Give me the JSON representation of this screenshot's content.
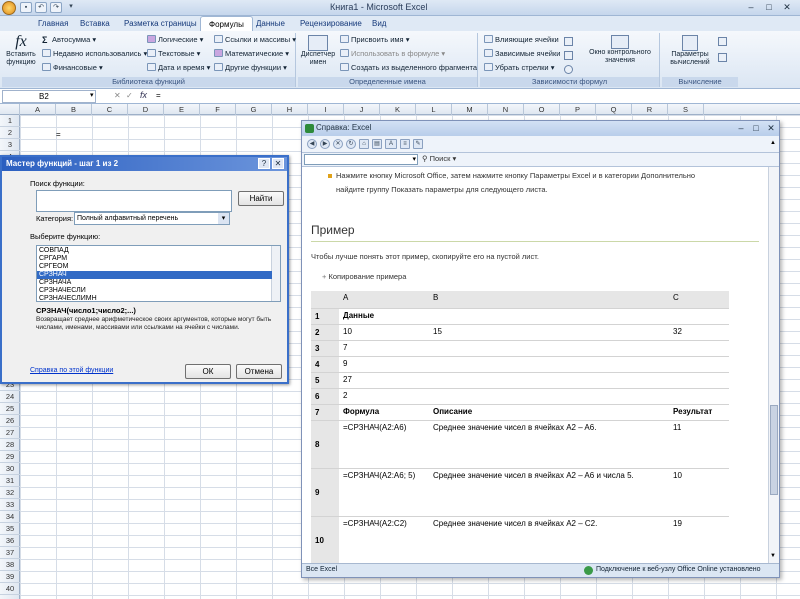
{
  "window": {
    "title": "Книга1 - Microsoft Excel"
  },
  "qat": [
    "save",
    "undo",
    "redo",
    "customize"
  ],
  "tabs": [
    "Главная",
    "Вставка",
    "Разметка страницы",
    "Формулы",
    "Данные",
    "Рецензирование",
    "Вид"
  ],
  "active_tab": "Формулы",
  "ribbon": {
    "insert_function": "Вставить функцию",
    "lib_col1": [
      "Автосумма",
      "Недавно использовались",
      "Финансовые"
    ],
    "lib_col2": [
      "Логические",
      "Текстовые",
      "Дата и время"
    ],
    "lib_col3": [
      "Ссылки и массивы",
      "Математические",
      "Другие функции"
    ],
    "group_library": "Библиотека функций",
    "name_manager": "Диспетчер имен",
    "names_items": [
      "Присвоить имя",
      "Использовать в формуле",
      "Создать из выделенного фрагмента"
    ],
    "group_names": "Определенные имена",
    "dep_items": [
      "Влияющие ячейки",
      "Зависимые ячейки",
      "Убрать стрелки"
    ],
    "watch_window": "Окно контрольного значения",
    "group_deps": "Зависимости формул",
    "calc_options": "Параметры вычислений",
    "group_calc": "Вычисление"
  },
  "formula_bar": {
    "name_box": "B2",
    "fx": "fx",
    "value": "="
  },
  "columns": [
    "A",
    "B",
    "C",
    "D",
    "E",
    "F",
    "G",
    "H",
    "I",
    "J",
    "K",
    "L",
    "M",
    "N",
    "O",
    "P",
    "Q",
    "R",
    "S"
  ],
  "rows": [
    "1",
    "2",
    "3",
    "4",
    "5",
    "6",
    "7",
    "8",
    "9",
    "10",
    "11",
    "12",
    "13",
    "14",
    "15",
    "16",
    "17",
    "18",
    "19",
    "20",
    "21",
    "22",
    "23",
    "24",
    "25",
    "26",
    "27",
    "28",
    "29",
    "30",
    "31",
    "32",
    "33",
    "34",
    "35",
    "36",
    "37",
    "38",
    "39",
    "40"
  ],
  "cell_b2": "=",
  "dialog": {
    "title": "Мастер функций - шаг 1 из 2",
    "search_label": "Поиск функции:",
    "find_btn": "Найти",
    "category_label": "Категория:",
    "category_value": "Полный алфавитный перечень",
    "select_label": "Выберите функцию:",
    "functions": [
      "СОВПАД",
      "СРГАРМ",
      "СРГЕОМ",
      "СРЗНАЧ",
      "СРЗНАЧА",
      "СРЗНАЧЕСЛИ",
      "СРЗНАЧЕСЛИМН"
    ],
    "selected_index": 3,
    "signature": "СРЗНАЧ(число1;число2;...)",
    "description": "Возвращает среднее арифметическое своих аргументов, которые могут быть числами, именами, массивами или ссылками на ячейки с числами.",
    "help_link": "Справка по этой функции",
    "ok": "ОК",
    "cancel": "Отмена"
  },
  "help": {
    "title": "Справка: Excel",
    "search_btn": "Поиск",
    "intro_1": "Нажмите кнопку Microsoft Office, затем нажмите кнопку Параметры Excel и в категории Дополнительно",
    "intro_2": "найдите группу Показать параметры для следующего листа.",
    "heading": "Пример",
    "subtext": "Чтобы лучше понять этот пример, скопируйте его на пустой лист.",
    "copy_link": "Копирование примера",
    "table_cols": [
      "A",
      "B",
      "C"
    ],
    "table_rows": [
      {
        "n": "1",
        "a": "Данные",
        "b": "",
        "c": "",
        "bold": true
      },
      {
        "n": "2",
        "a": "10",
        "b": "15",
        "c": "32"
      },
      {
        "n": "3",
        "a": "7",
        "b": "",
        "c": ""
      },
      {
        "n": "4",
        "a": "9",
        "b": "",
        "c": ""
      },
      {
        "n": "5",
        "a": "27",
        "b": "",
        "c": ""
      },
      {
        "n": "6",
        "a": "2",
        "b": "",
        "c": ""
      },
      {
        "n": "7",
        "a": "Формула",
        "b": "Описание",
        "c": "Результат",
        "bold": true
      },
      {
        "n": "8",
        "a": "=СРЗНАЧ(A2:A6)",
        "b": "Среднее значение чисел в ячейках A2 – A6.",
        "c": "11",
        "tall": true
      },
      {
        "n": "9",
        "a": "=СРЗНАЧ(A2:A6; 5)",
        "b": "Среднее значение чисел в ячейках A2 – A6 и числа 5.",
        "c": "10",
        "tall": true
      },
      {
        "n": "10",
        "a": "=СРЗНАЧ(A2:C2)",
        "b": "Среднее значение чисел в ячейках A2 – C2.",
        "c": "19",
        "tall": true
      }
    ],
    "status_left": "Все Excel",
    "status_right": "Подключение к веб-узлу Office Online установлено"
  }
}
